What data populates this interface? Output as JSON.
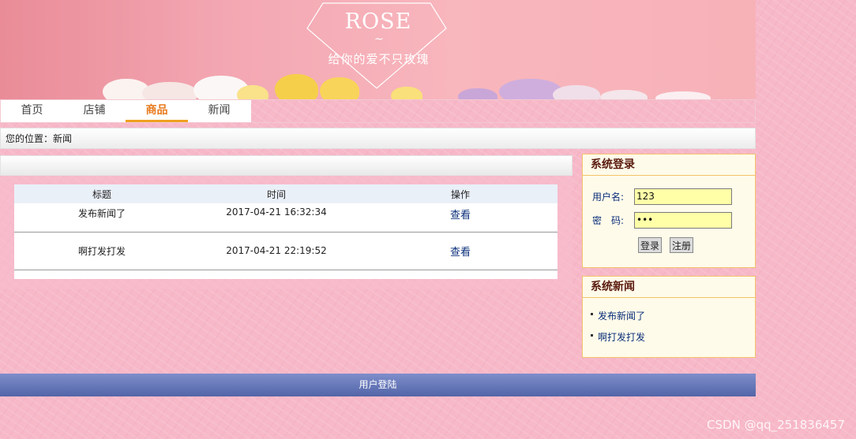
{
  "banner": {
    "title": "ROSE",
    "tilde": "~",
    "slogan": "给你的爱不只玫瑰"
  },
  "nav": {
    "items": [
      {
        "label": "首页",
        "active": false
      },
      {
        "label": "店铺",
        "active": false
      },
      {
        "label": "商品",
        "active": true
      },
      {
        "label": "新闻",
        "active": false
      }
    ]
  },
  "breadcrumb": {
    "text": "您的位置：新闻"
  },
  "news_table": {
    "headers": [
      "标题",
      "时间",
      "操作"
    ],
    "rows": [
      {
        "title": "发布新闻了",
        "time": "2017-04-21 16:32:34",
        "action": "查看"
      },
      {
        "title": "啊打发打发",
        "time": "2017-04-21 22:19:52",
        "action": "查看"
      }
    ]
  },
  "login": {
    "title": "系统登录",
    "username_label": "用户名:",
    "username_value": "123",
    "password_label": "密　码:",
    "password_value": "123",
    "login_button": "登录",
    "register_button": "注册"
  },
  "sysnews": {
    "title": "系统新闻",
    "items": [
      "发布新闻了",
      "啊打发打发"
    ]
  },
  "footer": {
    "text": "用户登陆"
  },
  "watermark": {
    "text": "CSDN @qq_251836457"
  },
  "colors": {
    "page_bg": "#f7b8c8",
    "nav_active": "#e87a1e",
    "link": "#0a2f7a",
    "footer": "#5265a8",
    "box_border": "#f4c36a",
    "box_bg": "#fffbea"
  }
}
